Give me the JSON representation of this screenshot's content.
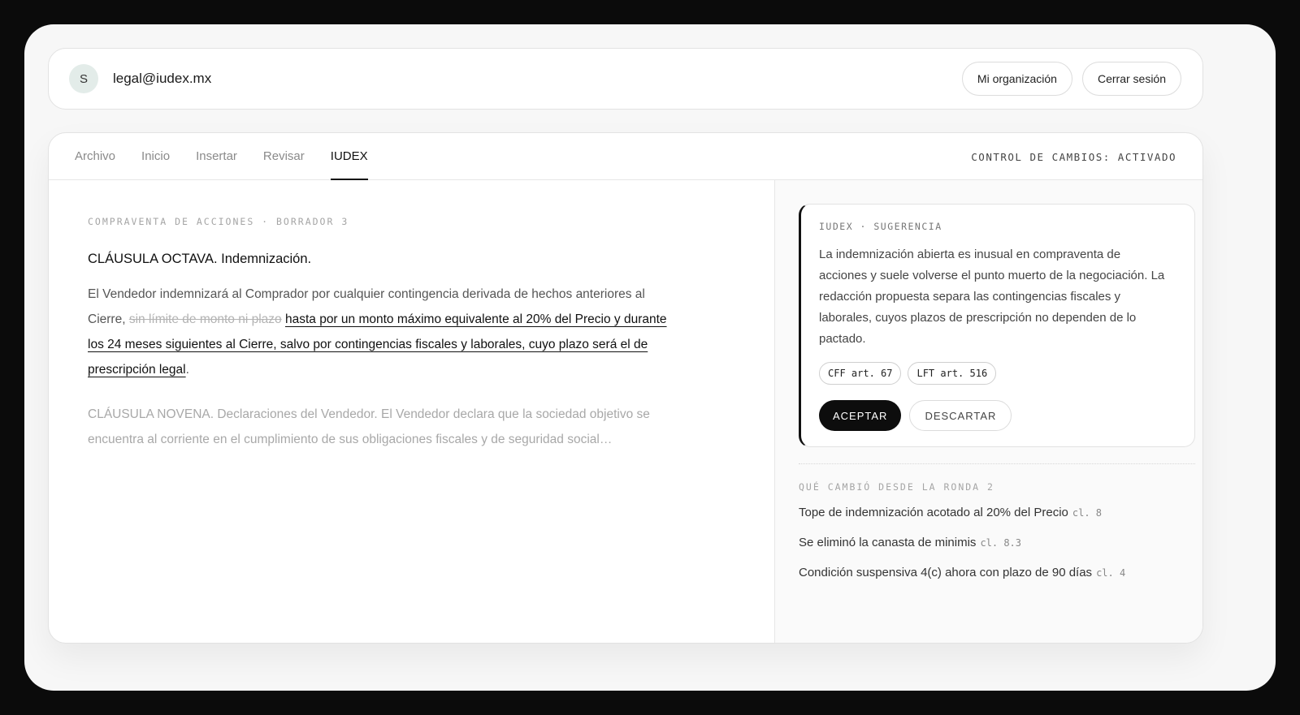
{
  "user": {
    "avatar_initial": "S",
    "email": "legal@iudex.mx"
  },
  "header_actions": {
    "organization": "Mi organización",
    "logout": "Cerrar sesión"
  },
  "tabs": [
    {
      "label": "Archivo",
      "active": false
    },
    {
      "label": "Inicio",
      "active": false
    },
    {
      "label": "Insertar",
      "active": false
    },
    {
      "label": "Revisar",
      "active": false
    },
    {
      "label": "IUDEX",
      "active": true
    }
  ],
  "track_changes_status": "CONTROL DE CAMBIOS: ACTIVADO",
  "document": {
    "meta": "COMPRAVENTA DE ACCIONES · BORRADOR 3",
    "clause_title": "CLÁUSULA OCTAVA. Indemnización.",
    "clause_body_start": "El Vendedor indemnizará al Comprador por cualquier contingencia derivada de hechos anteriores al Cierre, ",
    "clause_deleted": "sin límite de monto ni plazo",
    "clause_inserted": "hasta por un monto máximo equivalente al 20% del Precio y durante los 24 meses siguientes al Cierre, salvo por contingencias fiscales y laborales, cuyo plazo será el de prescripción legal",
    "clause_body_end": ".",
    "next_clause": "CLÁUSULA NOVENA. Declaraciones del Vendedor. El Vendedor declara que la sociedad objetivo se encuentra al corriente en el cumplimiento de sus obligaciones fiscales y de seguridad social…"
  },
  "suggestion": {
    "label": "IUDEX · SUGERENCIA",
    "text": "La indemnización abierta es inusual en compraventa de acciones y suele volverse el punto muerto de la negociación. La redacción propuesta separa las contingencias fiscales y laborales, cuyos plazos de prescripción no dependen de lo pactado.",
    "references": [
      "CFF art. 67",
      "LFT art. 516"
    ],
    "accept_label": "ACEPTAR",
    "discard_label": "DESCARTAR"
  },
  "changes": {
    "label": "QUÉ CAMBIÓ DESDE LA RONDA 2",
    "items": [
      {
        "text": "Tope de indemnización acotado al 20% del Precio",
        "ref": "cl. 8"
      },
      {
        "text": "Se eliminó la canasta de minimis",
        "ref": "cl. 8.3"
      },
      {
        "text": "Condición suspensiva 4(c) ahora con plazo de 90 días",
        "ref": "cl. 4"
      }
    ]
  }
}
